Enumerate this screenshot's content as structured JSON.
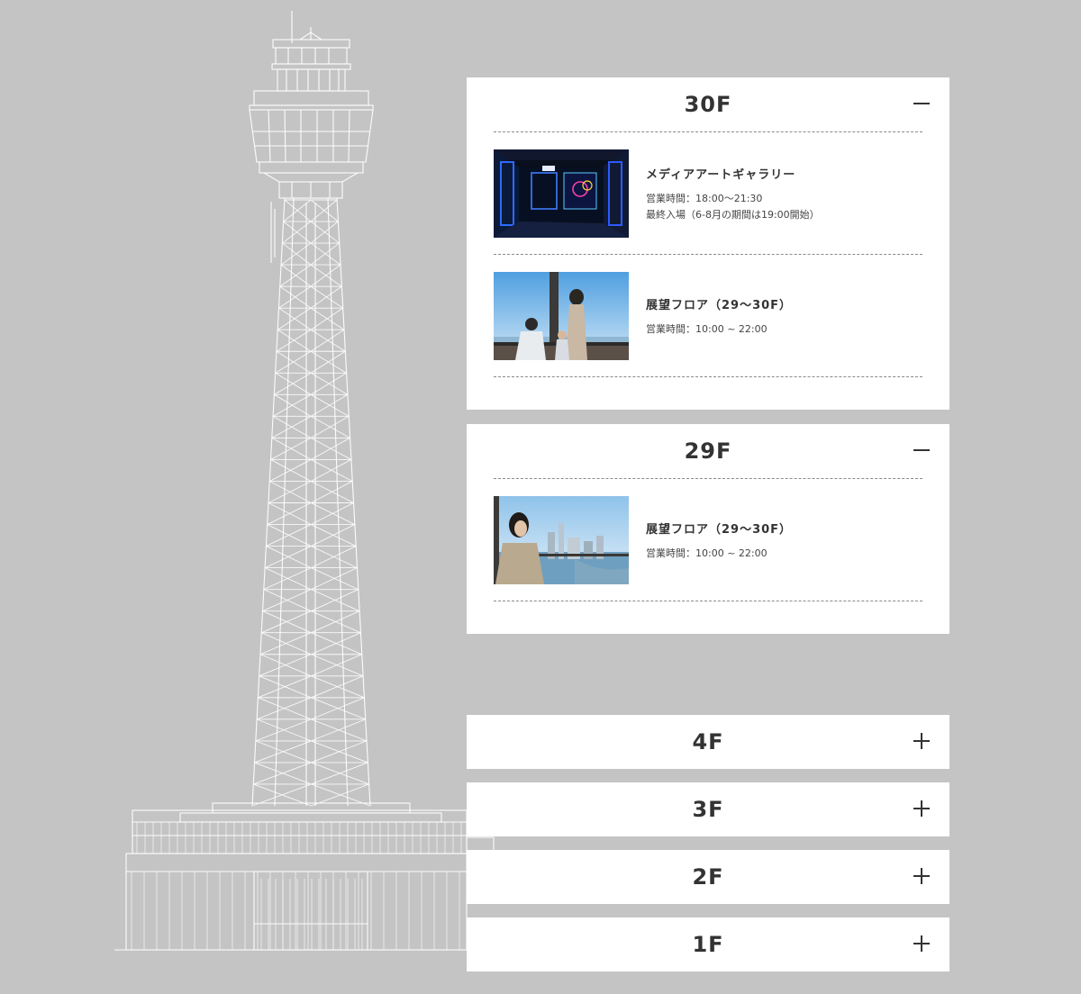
{
  "floors": [
    {
      "label": "30F",
      "toggle_state": "collapse",
      "facilities": [
        {
          "name": "メディアアートギャラリー",
          "hours": "営業時間：18:00〜21:30",
          "note": "最終入場（6-8月の期間は19:00開始）"
        },
        {
          "name": "展望フロア（29〜30F）",
          "hours": "営業時間：10:00 ~ 22:00"
        }
      ]
    },
    {
      "label": "29F",
      "toggle_state": "collapse",
      "facilities": [
        {
          "name": "展望フロア（29〜30F）",
          "hours": "営業時間：10:00 ~ 22:00"
        }
      ]
    },
    {
      "label": "4F",
      "toggle_state": "expand"
    },
    {
      "label": "3F",
      "toggle_state": "expand"
    },
    {
      "label": "2F",
      "toggle_state": "expand"
    },
    {
      "label": "1F",
      "toggle_state": "expand"
    }
  ],
  "icons": {
    "collapse": "minus-icon",
    "expand": "plus-icon"
  },
  "colors": {
    "background": "#c4c4c4",
    "panel": "#ffffff",
    "line_art": "#ffffff",
    "text": "#333333"
  }
}
